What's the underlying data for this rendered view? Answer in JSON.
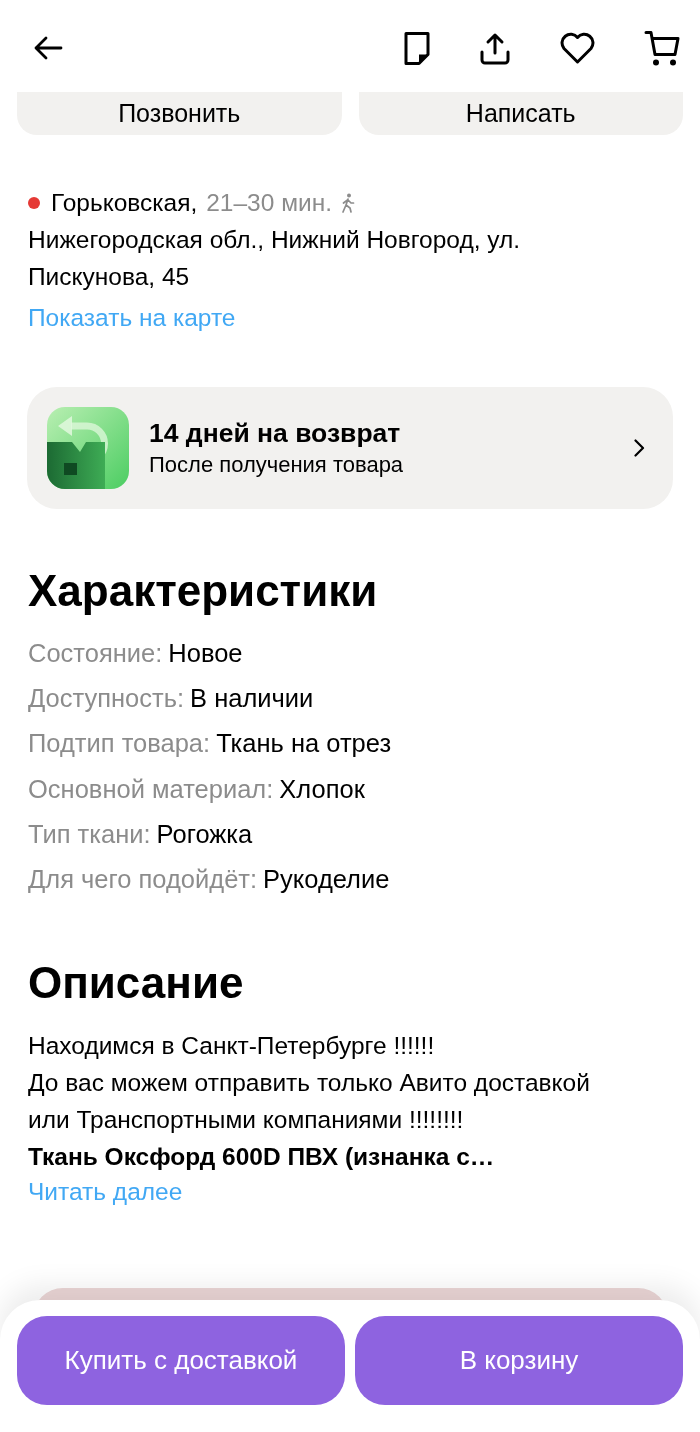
{
  "contact_buttons": [
    "Позвонить",
    "Написать"
  ],
  "location": {
    "metro": [
      {
        "station": "Горьковская,",
        "color": "#e53935",
        "travel_time": "21–30 мин."
      }
    ],
    "address": "Нижегородская обл., Нижний Новгород, ул. Пискунова, 45",
    "map_link": "Показать на карте"
  },
  "return_card": {
    "title": "14 дней на возврат",
    "subtitle": "После получения товара"
  },
  "specs": {
    "title": "Характеристики",
    "items": [
      {
        "label": "Состояние:",
        "value": "Новое"
      },
      {
        "label": "Доступность:",
        "value": "В наличии"
      },
      {
        "label": "Подтип товара:",
        "value": "Ткань на отрез"
      },
      {
        "label": "Основной материал:",
        "value": "Хлопок"
      },
      {
        "label": "Тип ткани:",
        "value": "Рогожка"
      },
      {
        "label": "Для чего подойдёт:",
        "value": "Рукоделие"
      }
    ]
  },
  "description": {
    "title": "Описание",
    "paragraphs": [
      {
        "kind": "plain",
        "text": "Находимся в Санкт-Петербурге !!!!!!"
      },
      {
        "kind": "plain",
        "text": "До вас можем отправить только Авито доставкой или Транспортными компаниями !!!!!!!!"
      },
      {
        "kind": "bold",
        "text": "Ткань Оксфорд 600D ПВХ (изнанка с…"
      }
    ],
    "read_more": "Читать далее"
  },
  "bottom_bar": {
    "buttons": [
      "Купить с доставкой",
      "В корзину"
    ]
  }
}
